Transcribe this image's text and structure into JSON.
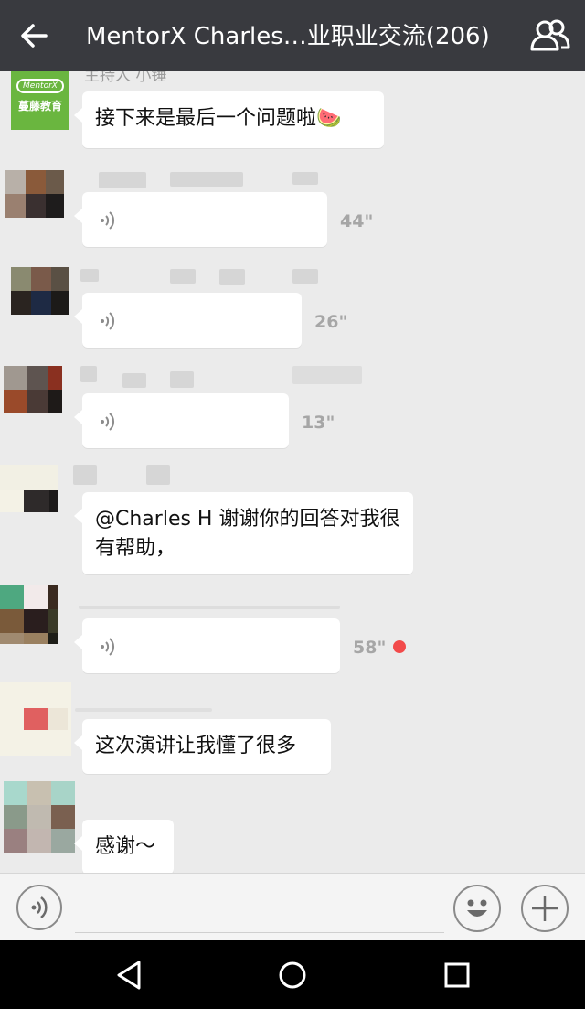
{
  "header": {
    "title": "MentorX Charles…业职业交流(206)",
    "back_icon": "arrow-left-icon",
    "group_icon": "group-members-icon"
  },
  "messages": [
    {
      "type": "text",
      "sender": "主持人 小锤",
      "avatar_text": "MentorX",
      "avatar_sub": "蔓藤教育",
      "text": "接下来是最后一个问题啦🍉"
    },
    {
      "type": "voice",
      "duration": "44\""
    },
    {
      "type": "voice",
      "duration": "26\""
    },
    {
      "type": "voice",
      "duration": "13\""
    },
    {
      "type": "text",
      "text": "@Charles H 谢谢你的回答对我很有帮助，"
    },
    {
      "type": "voice",
      "duration": "58\"",
      "unread": true
    },
    {
      "type": "text",
      "text": "这次演讲让我懂了很多"
    },
    {
      "type": "text",
      "text": "感谢〜"
    }
  ],
  "inputbar": {
    "voice_icon": "voice-input-icon",
    "emoji_icon": "emoji-icon",
    "plus_icon": "plus-icon"
  },
  "navbar": {
    "back_icon": "nav-back-triangle-icon",
    "home_icon": "nav-home-circle-icon",
    "recent_icon": "nav-recents-square-icon"
  },
  "colors": {
    "header_bg": "#393a3f",
    "chat_bg": "#ebebeb",
    "bubble_bg": "#ffffff",
    "unread_dot": "#f24a4a",
    "brand_green": "#6ab63f"
  }
}
